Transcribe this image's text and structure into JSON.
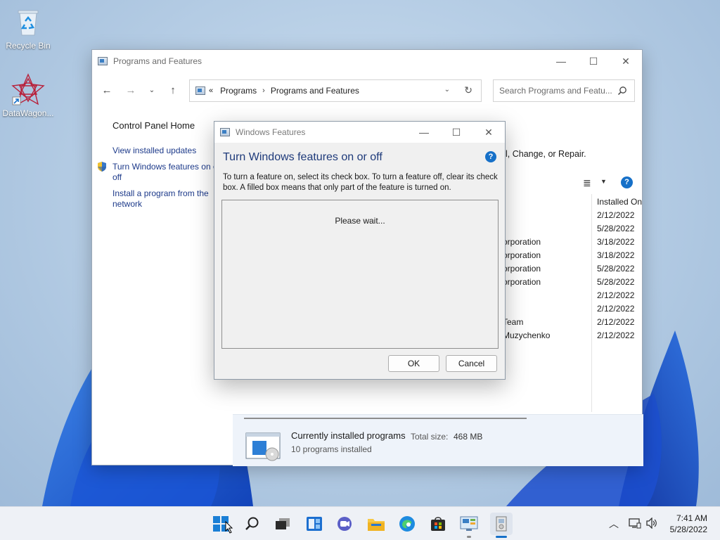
{
  "desktop": {
    "icons": [
      {
        "label": "Recycle Bin"
      },
      {
        "label": "DataWagon..."
      }
    ]
  },
  "main_window": {
    "title": "Programs and Features",
    "address": {
      "overflow": "«",
      "crumbs": [
        "Programs",
        "Programs and Features"
      ]
    },
    "search_placeholder": "Search Programs and Featu...",
    "left_pane": {
      "home": "Control Panel Home",
      "view_updates": "View installed updates",
      "turn_features_line1": "Turn Windows features on o",
      "turn_features_line2": "off",
      "install_line1": "Install a program from the",
      "install_line2": "network"
    },
    "header_text": "l, Change, or Repair.",
    "columns": {
      "installed_on": "Installed On"
    },
    "rows": [
      {
        "publisher": "",
        "date": "2/12/2022"
      },
      {
        "publisher": "",
        "date": "5/28/2022"
      },
      {
        "publisher": "orporation",
        "date": "3/18/2022"
      },
      {
        "publisher": "orporation",
        "date": "3/18/2022"
      },
      {
        "publisher": "orporation",
        "date": "5/28/2022"
      },
      {
        "publisher": "orporation",
        "date": "5/28/2022"
      },
      {
        "publisher": "",
        "date": "2/12/2022"
      },
      {
        "publisher": "",
        "date": "2/12/2022"
      },
      {
        "publisher": "Team",
        "date": "2/12/2022"
      },
      {
        "publisher": "Muzychenko",
        "date": "2/12/2022"
      }
    ],
    "details": {
      "title": "Currently installed programs",
      "total_size_label": "Total size:",
      "total_size_value": "468 MB",
      "count": "10 programs installed"
    }
  },
  "dialog": {
    "title": "Windows Features",
    "heading": "Turn Windows features on or off",
    "help": "?",
    "description": "To turn a feature on, select its check box. To turn a feature off, clear its check box. A filled box means that only part of the feature is turned on.",
    "status": "Please wait...",
    "ok_label": "OK",
    "cancel_label": "Cancel"
  },
  "taskbar": {
    "clock_time": "7:41 AM",
    "clock_date": "5/28/2022"
  },
  "colors": {
    "link": "#1d3a8a",
    "heading": "#1e3a7a",
    "accent": "#1670c8"
  }
}
